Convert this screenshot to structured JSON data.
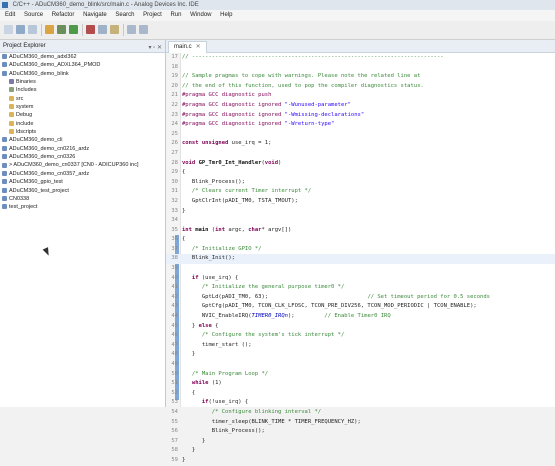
{
  "window": {
    "title": "C/C++ - ADuCM360_demo_blink/src/main.c - Analog Devices Inc. IDE"
  },
  "menu": [
    "Edit",
    "Source",
    "Refactor",
    "Navigate",
    "Search",
    "Project",
    "Run",
    "Window",
    "Help"
  ],
  "explorer": {
    "tab_label": "Project Explorer",
    "items": [
      {
        "label": "ADuCM360_demo_adxl362",
        "icon": "project-icon",
        "indent": 0
      },
      {
        "label": "ADuCM360_demo_ADXL364_PMOD",
        "icon": "project-icon",
        "indent": 0
      },
      {
        "label": "ADuCM360_demo_blink",
        "icon": "project-icon",
        "indent": 0
      },
      {
        "label": "Binaries",
        "icon": "binaries-icon",
        "indent": 1
      },
      {
        "label": "Includes",
        "icon": "includes-icon",
        "indent": 1
      },
      {
        "label": "src",
        "icon": "folder-icon",
        "indent": 1
      },
      {
        "label": "system",
        "icon": "folder-icon",
        "indent": 1
      },
      {
        "label": "Debug",
        "icon": "folder-icon",
        "indent": 1
      },
      {
        "label": "include",
        "icon": "folder-icon",
        "indent": 1
      },
      {
        "label": "ldscripts",
        "icon": "folder-icon",
        "indent": 1
      },
      {
        "label": "ADuCM360_demo_cli",
        "icon": "project-icon",
        "indent": 0
      },
      {
        "label": "ADuCM360_demo_cn0216_ardz",
        "icon": "project-icon",
        "indent": 0
      },
      {
        "label": "ADuCM360_demo_cn0326",
        "icon": "project-icon",
        "indent": 0
      },
      {
        "label": "> ADuCM360_demo_cn0337 [CN0 - ADICUP360 inc]",
        "icon": "project-icon",
        "indent": 0
      },
      {
        "label": "ADuCM360_demo_cn0357_ardz",
        "icon": "project-icon",
        "indent": 0
      },
      {
        "label": "ADuCM360_gpio_test",
        "icon": "project-icon",
        "indent": 0
      },
      {
        "label": "ADuCM360_test_project",
        "icon": "project-icon",
        "indent": 0
      },
      {
        "label": "CN0338",
        "icon": "project-icon",
        "indent": 0
      },
      {
        "label": "test_project",
        "icon": "project-icon",
        "indent": 0
      }
    ]
  },
  "editor": {
    "tab_label": "main.c",
    "lines": [
      {
        "n": "17",
        "segs": [
          {
            "c": "cmt",
            "t": "// ----------------------------------------------------------------------------"
          }
        ]
      },
      {
        "n": "18",
        "segs": []
      },
      {
        "n": "19",
        "segs": [
          {
            "c": "cmt",
            "t": "// Sample pragmas to cope with warnings. Please note the related line at"
          }
        ]
      },
      {
        "n": "20",
        "segs": [
          {
            "c": "cmt",
            "t": "// the end of this function, used to pop the compiler diagnostics status."
          }
        ]
      },
      {
        "n": "21",
        "segs": [
          {
            "c": "pp",
            "t": "#pragma GCC diagnostic push"
          }
        ]
      },
      {
        "n": "22",
        "segs": [
          {
            "c": "pp",
            "t": "#pragma GCC diagnostic ignored "
          },
          {
            "c": "str",
            "t": "\"-Wunused-parameter\""
          }
        ]
      },
      {
        "n": "23",
        "segs": [
          {
            "c": "pp",
            "t": "#pragma GCC diagnostic ignored "
          },
          {
            "c": "str",
            "t": "\"-Wmissing-declarations\""
          }
        ]
      },
      {
        "n": "24",
        "segs": [
          {
            "c": "pp",
            "t": "#pragma GCC diagnostic ignored "
          },
          {
            "c": "str",
            "t": "\"-Wreturn-type\""
          }
        ]
      },
      {
        "n": "25",
        "segs": []
      },
      {
        "n": "26",
        "segs": [
          {
            "c": "kw",
            "t": "const unsigned "
          },
          {
            "c": "tx",
            "t": "use_irq = 1;"
          }
        ]
      },
      {
        "n": "27",
        "segs": []
      },
      {
        "n": "28",
        "segs": [
          {
            "c": "kw",
            "t": "void "
          },
          {
            "c": "fn",
            "t": "GP_Tmr0_Int_Handler"
          },
          {
            "c": "tx",
            "t": "("
          },
          {
            "c": "kw",
            "t": "void"
          },
          {
            "c": "tx",
            "t": ")"
          }
        ]
      },
      {
        "n": "29",
        "segs": [
          {
            "c": "tx",
            "t": "{"
          }
        ]
      },
      {
        "n": "30",
        "segs": [
          {
            "c": "tx",
            "t": "   Blink_Process();"
          }
        ]
      },
      {
        "n": "31",
        "segs": [
          {
            "c": "cmt",
            "t": "   /* Clears current Timer interrupt */"
          }
        ]
      },
      {
        "n": "32",
        "segs": [
          {
            "c": "tx",
            "t": "   GptClrInt(pADI_TM0, TSTA_TMOUT);"
          }
        ]
      },
      {
        "n": "33",
        "segs": [
          {
            "c": "tx",
            "t": "}"
          }
        ]
      },
      {
        "n": "34",
        "segs": []
      },
      {
        "n": "35",
        "segs": [
          {
            "c": "kw",
            "t": "int "
          },
          {
            "c": "fn",
            "t": "main"
          },
          {
            "c": "tx",
            "t": " ("
          },
          {
            "c": "kw",
            "t": "int "
          },
          {
            "c": "tx",
            "t": "argc, "
          },
          {
            "c": "kw",
            "t": "char"
          },
          {
            "c": "tx",
            "t": "* argv[])"
          }
        ]
      },
      {
        "n": "36",
        "segs": [
          {
            "c": "tx",
            "t": "{"
          }
        ]
      },
      {
        "n": "37",
        "segs": [
          {
            "c": "cmt",
            "t": "   /* Initialize GPIO */"
          }
        ]
      },
      {
        "n": "38",
        "segs": [
          {
            "c": "tx",
            "t": "   Blink_Init();"
          }
        ],
        "current": true
      },
      {
        "n": "39",
        "segs": []
      },
      {
        "n": "40",
        "segs": [
          {
            "c": "kw",
            "t": "   if "
          },
          {
            "c": "tx",
            "t": "(use_irq) {"
          }
        ]
      },
      {
        "n": "41",
        "segs": [
          {
            "c": "cmt",
            "t": "      /* Initialize the general purpose timer0 */"
          }
        ]
      },
      {
        "n": "42",
        "segs": [
          {
            "c": "tx",
            "t": "      GptLd(pADI_TM0, 63);                              "
          },
          {
            "c": "cmt",
            "t": "// Set timeout period for 0.5 seconds"
          }
        ]
      },
      {
        "n": "43",
        "segs": [
          {
            "c": "tx",
            "t": "      GptCfg(pADI_TM0, TCON_CLK_LFOSC, TCON_PRE_DIV256, TCON_MOD_PERIODIC | TCON_ENABLE);"
          }
        ]
      },
      {
        "n": "44",
        "segs": [
          {
            "c": "tx",
            "t": "      NVIC_EnableIRQ("
          },
          {
            "c": "mac",
            "t": "TIMER0_IRQn"
          },
          {
            "c": "tx",
            "t": ");         "
          },
          {
            "c": "cmt",
            "t": "// Enable Timer0 IRQ"
          }
        ]
      },
      {
        "n": "45",
        "segs": [
          {
            "c": "tx",
            "t": "   } "
          },
          {
            "c": "kw",
            "t": "else "
          },
          {
            "c": "tx",
            "t": "{"
          }
        ]
      },
      {
        "n": "46",
        "segs": [
          {
            "c": "cmt",
            "t": "      /* Configure the system's tick interrupt */"
          }
        ]
      },
      {
        "n": "47",
        "segs": [
          {
            "c": "tx",
            "t": "      timer_start ();"
          }
        ]
      },
      {
        "n": "48",
        "segs": [
          {
            "c": "tx",
            "t": "   }"
          }
        ]
      },
      {
        "n": "49",
        "segs": []
      },
      {
        "n": "50",
        "segs": [
          {
            "c": "cmt",
            "t": "   /* Main Program Loop */"
          }
        ]
      },
      {
        "n": "51",
        "segs": [
          {
            "c": "kw",
            "t": "   while "
          },
          {
            "c": "tx",
            "t": "(1)"
          }
        ]
      },
      {
        "n": "52",
        "segs": [
          {
            "c": "tx",
            "t": "   {"
          }
        ]
      },
      {
        "n": "53",
        "segs": [
          {
            "c": "kw",
            "t": "      if"
          },
          {
            "c": "tx",
            "t": "(!use_irq) {"
          }
        ]
      },
      {
        "n": "54",
        "segs": [
          {
            "c": "cmt",
            "t": "         /* Configure blinking interval */"
          }
        ]
      },
      {
        "n": "55",
        "segs": [
          {
            "c": "tx",
            "t": "         timer_sleep(BLINK_TIME * TIMER_FREQUENCY_HZ);"
          }
        ]
      },
      {
        "n": "56",
        "segs": [
          {
            "c": "tx",
            "t": "         Blink_Process();"
          }
        ]
      },
      {
        "n": "57",
        "segs": [
          {
            "c": "tx",
            "t": "      }"
          }
        ]
      },
      {
        "n": "58",
        "segs": [
          {
            "c": "tx",
            "t": "   }"
          }
        ]
      },
      {
        "n": "59",
        "segs": [
          {
            "c": "tx",
            "t": "}"
          }
        ]
      }
    ]
  },
  "colors": {
    "comment": "#3a8a3a",
    "keyword": "#7f0055",
    "string": "#2a00ff",
    "macro": "#0000c0",
    "gutter_marker": "#7ea7d8"
  }
}
